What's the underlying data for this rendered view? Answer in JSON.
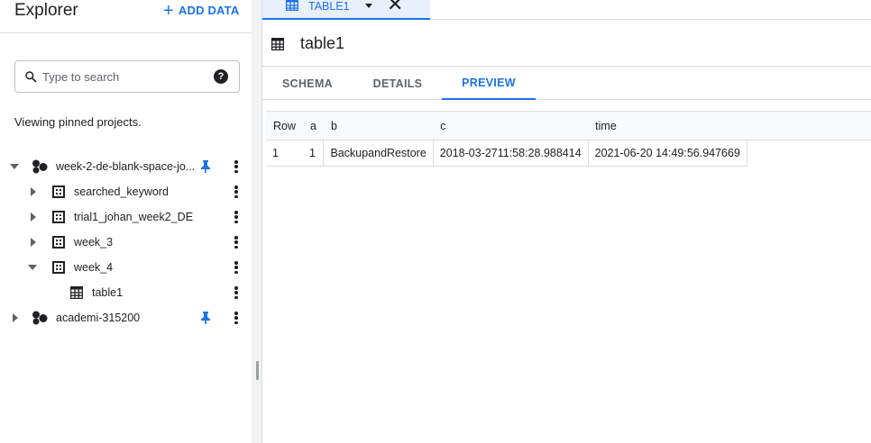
{
  "explorer": {
    "title": "Explorer",
    "add_data_label": "ADD DATA",
    "search_placeholder": "Type to search",
    "pinned_note": "Viewing pinned projects."
  },
  "tree": [
    {
      "label": "week-2-de-blank-space-jo...",
      "icon": "project-icon",
      "expanded": true,
      "pinned": true
    },
    {
      "label": "searched_keyword",
      "icon": "dataset-icon",
      "expanded": false
    },
    {
      "label": "trial1_johan_week2_DE",
      "icon": "dataset-icon",
      "expanded": false
    },
    {
      "label": "week_3",
      "icon": "dataset-icon",
      "expanded": false
    },
    {
      "label": "week_4",
      "icon": "dataset-icon",
      "expanded": true
    },
    {
      "label": "table1",
      "icon": "table-icon"
    },
    {
      "label": "academi-315200",
      "icon": "project-icon",
      "expanded": false,
      "pinned": true
    }
  ],
  "editor_tab": {
    "label": "TABLE1"
  },
  "table": {
    "title": "table1"
  },
  "subtabs": [
    "SCHEMA",
    "DETAILS",
    "PREVIEW"
  ],
  "active_subtab": "PREVIEW",
  "preview": {
    "columns": [
      "Row",
      "a",
      "b",
      "c",
      "time"
    ],
    "rows": [
      [
        "1",
        "1",
        "BackupandRestore",
        "2018-03-2711:58:28.988414",
        "2021-06-20 14:49:56.947669"
      ]
    ]
  },
  "colors": {
    "accent": "#1a73e8",
    "text": "#202124",
    "muted": "#5f6368",
    "border": "#dadce0"
  }
}
